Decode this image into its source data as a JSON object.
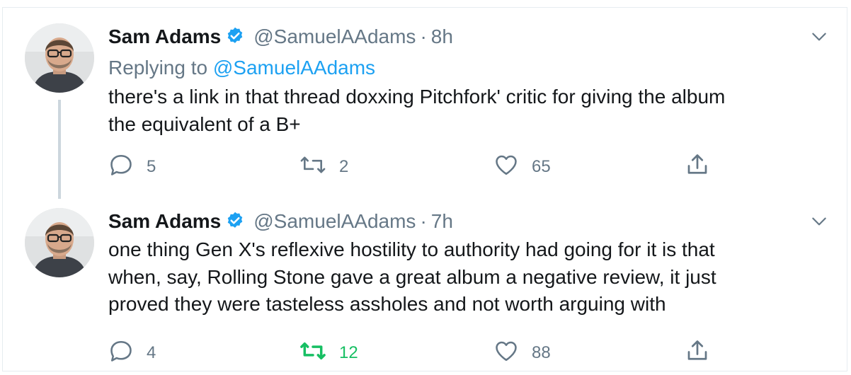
{
  "tweets": [
    {
      "name": "Sam Adams",
      "handle": "@SamuelAAdams",
      "separator": "·",
      "time": "8h",
      "replying_prefix": "Replying to",
      "replying_handle": "@SamuelAAdams",
      "text_lines": [
        "there's a link in that thread doxxing Pitchfork' critic for giving the album",
        "the equivalent of a B+"
      ],
      "replies": "5",
      "retweets": "2",
      "likes": "65",
      "retweeted": false
    },
    {
      "name": "Sam Adams",
      "handle": "@SamuelAAdams",
      "separator": "·",
      "time": "7h",
      "text_lines": [
        "one thing Gen X's reflexive hostility to authority had going for it is that",
        "when, say, Rolling Stone gave a great album a negative review, it just",
        "proved they were tasteless assholes and not worth arguing with"
      ],
      "replies": "4",
      "retweets": "12",
      "likes": "88",
      "retweeted": true
    }
  ],
  "colors": {
    "text": "#14171a",
    "secondary": "#657786",
    "accent": "#1da1f2",
    "retweet_active": "#17bf63",
    "border": "#e6ecf0"
  },
  "icons": {
    "verified": "verified-badge-icon",
    "caret": "chevron-down-icon",
    "reply": "reply-bubble-icon",
    "retweet": "retweet-icon",
    "like": "heart-icon",
    "share": "share-icon"
  }
}
